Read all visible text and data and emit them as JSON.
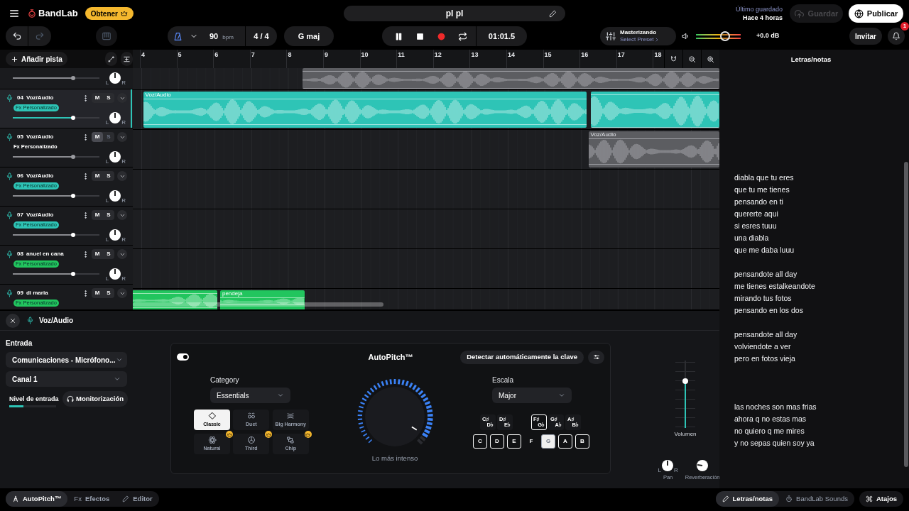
{
  "header": {
    "brand": "BandLab",
    "upgrade_button": "Obtener",
    "project_title": "pl pl",
    "save_status_label": "Último guardado",
    "save_status_time": "Hace 4 horas",
    "save_button": {
      "label": "Guardar",
      "disabled": true
    },
    "publish_button": "Publicar"
  },
  "toolbar": {
    "tempo": "90",
    "tempo_unit": "bpm",
    "time_signature": "4 / 4",
    "key": "G maj",
    "playing": true,
    "time": "01:01.5",
    "mastering_title": "Masterizando",
    "mastering_preset": "Select Preset",
    "master_volume": {
      "level": 0.65
    },
    "master_gain": "+0.0 dB",
    "invite_button": "Invitar",
    "notification_count": "1"
  },
  "arrange": {
    "add_track_button": "Añadir pista",
    "ruler": [
      "4",
      "5",
      "6",
      "7",
      "8",
      "9",
      "10",
      "11",
      "12",
      "13",
      "14",
      "15",
      "16",
      "17",
      "18"
    ]
  },
  "tracks": [
    {
      "partial": true,
      "muted": true,
      "selected": false,
      "volume": {
        "level": 0.7
      },
      "pan_labels": [
        "L",
        "R"
      ],
      "clips": [
        {
          "kind": "audio"
        }
      ]
    },
    {
      "partial": false,
      "number": "04",
      "name": "Voz/Audio",
      "fx": "Fx Personalizado",
      "mute_label": "M",
      "solo_label": "S",
      "color": "#2ec4b6",
      "selected": true,
      "muted": false,
      "volume": {
        "level": 0.7
      },
      "pan_labels": [
        "L",
        "R"
      ],
      "clips": [
        {
          "kind": "audio",
          "label": "Voz/Audio"
        },
        {
          "kind": "audio"
        }
      ]
    },
    {
      "partial": false,
      "number": "05",
      "name": "Voz/Audio",
      "fx": "Fx Personalizado",
      "mute_label": "M",
      "solo_label": "S",
      "selected": false,
      "muted": true,
      "volume": {
        "level": 0.7
      },
      "pan_labels": [
        "L",
        "R"
      ],
      "clips": [
        {
          "kind": "audio",
          "label": "Voz/Audio"
        }
      ]
    },
    {
      "partial": false,
      "number": "06",
      "name": "Voz/Audio",
      "fx": "Fx Personalizado",
      "mute_label": "M",
      "solo_label": "S",
      "color": "#2ec4b6",
      "selected": false,
      "muted": false,
      "volume": {
        "level": 0.7
      },
      "pan_labels": [
        "L",
        "R"
      ]
    },
    {
      "partial": false,
      "number": "07",
      "name": "Voz/Audio",
      "fx": "Fx Personalizado",
      "mute_label": "M",
      "solo_label": "S",
      "color": "#2ec4b6",
      "selected": false,
      "muted": false,
      "volume": {
        "level": 0.7
      },
      "pan_labels": [
        "L",
        "R"
      ]
    },
    {
      "partial": false,
      "number": "08",
      "name": "anuel en cana",
      "fx": "Fx Personalizado",
      "mute_label": "M",
      "solo_label": "S",
      "color": "#22c55e",
      "selected": false,
      "muted": false,
      "volume": {
        "level": 0.7
      },
      "pan_labels": [
        "L",
        "R"
      ]
    },
    {
      "partial": false,
      "number": "09",
      "name": "di maria",
      "fx": "Fx Personalizado",
      "mute_label": "M",
      "solo_label": "S",
      "color": "#22c55e",
      "selected": false,
      "muted": false,
      "clips": [
        {
          "kind": "audio"
        },
        {
          "kind": "audio",
          "label": "pendeja"
        }
      ]
    }
  ],
  "track_editor": {
    "track_name": "Voz/Audio",
    "input_label": "Entrada",
    "input_device": "Comunicaciones - Micrófono...",
    "input_channel": "Canal 1",
    "input_level_label": "Nivel de entrada",
    "input_level": {
      "level": 0.3
    },
    "monitoring_button": "Monitorización",
    "autopitch": {
      "enabled": true,
      "title": "AutoPitch™",
      "detect_key_button": "Detectar automáticamente la clave",
      "category_label": "Category",
      "category": "Essentials",
      "presets": [
        {
          "label": "Classic",
          "kind": "classic",
          "selected": true,
          "premium": false
        },
        {
          "label": "Duet",
          "kind": "duet",
          "selected": false,
          "premium": false
        },
        {
          "label": "Big Harmony",
          "kind": "harmony",
          "selected": false,
          "premium": false
        },
        {
          "label": "Natural",
          "kind": "natural",
          "selected": false,
          "premium": true
        },
        {
          "label": "Third",
          "kind": "third",
          "selected": false,
          "premium": true
        },
        {
          "label": "Chip",
          "kind": "chip",
          "selected": false,
          "premium": true
        }
      ],
      "intensity": {
        "level": 0.95
      },
      "intensity_label": "Lo más intenso",
      "scale_label": "Escala",
      "scale": "Major",
      "sharp_keys": [
        {
          "sharp": "C♯",
          "flat": "D♭",
          "in_scale": false,
          "selected": false
        },
        {
          "sharp": "D♯",
          "flat": "E♭",
          "in_scale": false,
          "selected": false
        },
        {
          "sharp": "F♯",
          "flat": "G♭",
          "in_scale": true,
          "selected": false
        },
        {
          "sharp": "G♯",
          "flat": "A♭",
          "in_scale": false,
          "selected": false
        },
        {
          "sharp": "A♯",
          "flat": "B♭",
          "in_scale": false,
          "selected": false
        }
      ],
      "natural_keys": [
        {
          "label": "C",
          "in_scale": true,
          "selected": false
        },
        {
          "label": "D",
          "in_scale": true,
          "selected": false
        },
        {
          "label": "E",
          "in_scale": true,
          "selected": false
        },
        {
          "label": "F",
          "in_scale": false,
          "selected": false
        },
        {
          "label": "G",
          "in_scale": true,
          "selected": true
        },
        {
          "label": "A",
          "in_scale": true,
          "selected": false
        },
        {
          "label": "B",
          "in_scale": true,
          "selected": false
        }
      ]
    },
    "mixer": {
      "volume": {
        "level": 0.7
      },
      "volume_label": "Volumen",
      "pan": {
        "level": 0.5
      },
      "pan_labels": [
        "L",
        "R"
      ],
      "pan_label": "Pan",
      "reverb": {
        "level": 0.2
      },
      "reverb_label": "Reverberación"
    }
  },
  "lyrics_panel": {
    "title": "Letras/notas",
    "text": "diabla que tu eres\nque tu me tienes\npensando en ti\nquererte aqui\nsi esres tuuu\nuna diabla\nque me daba luuu\n\npensandote all day\nme tienes estalkeandote\nmirando tus fotos\npensando en los dos\n\npensandote all day\nvolviendote a ver\npero en fotos vieja\n\n\n\nlas noches son mas frias\nahora q no estas mas\nno quiero q me mires\ny no sepas quien soy ya"
  },
  "bottom_tabs": [
    {
      "label": "AutoPitch™",
      "kind": "autopitch",
      "selected": true
    },
    {
      "label": "Efectos",
      "prefix": "Fx",
      "kind": "effects",
      "selected": false
    },
    {
      "label": "Editor",
      "kind": "editor",
      "selected": false
    }
  ],
  "side_tabs": [
    {
      "label": "Letras/notas",
      "kind": "lyrics",
      "selected": true
    },
    {
      "label": "BandLab Sounds",
      "kind": "sounds",
      "selected": false
    }
  ],
  "shortcuts_button": "Atajos"
}
